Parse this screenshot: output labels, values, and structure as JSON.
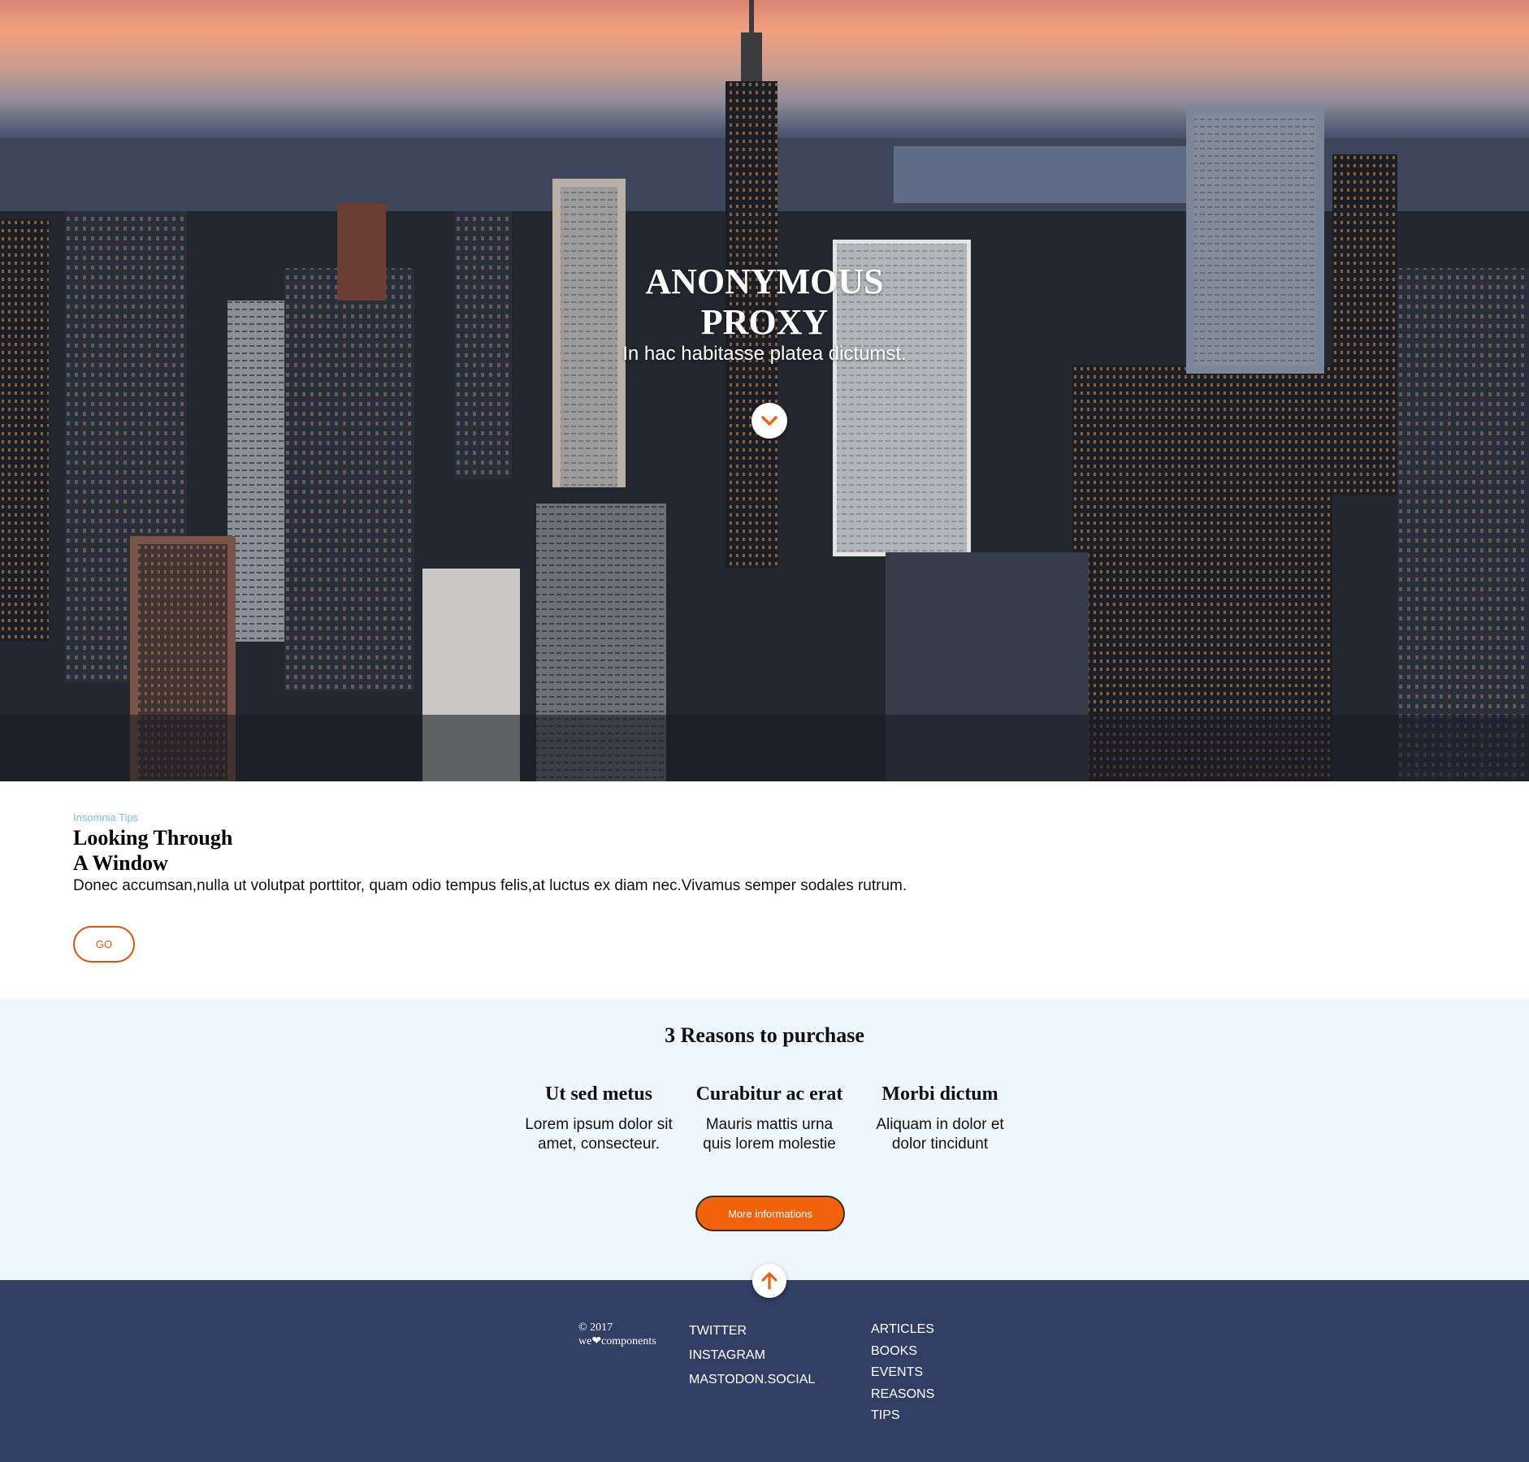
{
  "hero": {
    "title_line1": "ANONYMOUS",
    "title_line2": "PROXY",
    "subtitle": "In hac habitasse platea dictumst.",
    "scroll_icon": "chevron-down-icon",
    "background_description_colors": {
      "sky_top": "#e7866e",
      "sky_mid": "#7d7f93",
      "city": "#262b39"
    }
  },
  "article": {
    "category": "Insomnia Tips",
    "title_line1": "Looking Through",
    "title_line2": "A Window",
    "text": "Donec accumsan,nulla ut volutpat porttitor, quam odio tempus felis,at luctus ex diam nec.Vivamus semper sodales rutrum.",
    "button_label": "GO"
  },
  "reasons": {
    "title": "3 Reasons to purchase",
    "items": [
      {
        "heading": "Ut sed metus",
        "line1": "Lorem ipsum dolor sit",
        "line2": "amet, consecteur."
      },
      {
        "heading": "Curabitur ac erat",
        "line1": "Mauris mattis urna",
        "line2": "quis lorem molestie"
      },
      {
        "heading": "Morbi dictum",
        "line1": "Aliquam in dolor et",
        "line2": "dolor tincidunt"
      }
    ],
    "button_label": "More informations"
  },
  "footer": {
    "copyright_year": "© 2017",
    "copyright_brand": "we❤components",
    "scroll_icon": "arrow-up-icon",
    "social_links": [
      "TWITTER",
      "INSTAGRAM",
      "MASTODON.SOCIAL"
    ],
    "section_links": [
      "ARTICLES",
      "BOOKS",
      "EVENTS",
      "REASONS",
      "TIPS"
    ]
  },
  "colors": {
    "accent_orange": "#f0620c",
    "accent_dark_orange": "#d45a12",
    "category_blue": "#7cbbdc",
    "reasons_bg": "#eff7fe",
    "footer_bg": "#313f65"
  }
}
